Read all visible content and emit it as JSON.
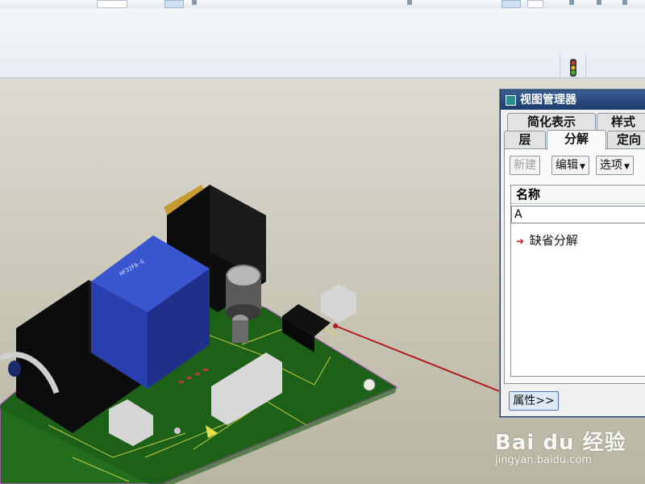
{
  "view_manager": {
    "title": "视图管理器",
    "tabs_row1": [
      "简化表示",
      "样式"
    ],
    "tabs_row2": [
      "层",
      "分解",
      "定向"
    ],
    "active_tab": "分解",
    "buttons": {
      "new": "新建",
      "edit": "编辑",
      "options": "选项"
    },
    "list_header": "名称",
    "list_input_value": "A",
    "items": [
      "缺省分解"
    ],
    "properties_button": "属性>>"
  },
  "watermark": {
    "brand": "Bai du 经验",
    "url": "jingyan.baidu.com"
  },
  "colors": {
    "pcb": "#1f6b1a",
    "relay": "#2a3fae",
    "title_bar": "#244676",
    "arrow": "#b01e1e"
  },
  "icons": {
    "traffic_light": "traffic-light-icon",
    "item_marker": "red-arrow-icon"
  }
}
